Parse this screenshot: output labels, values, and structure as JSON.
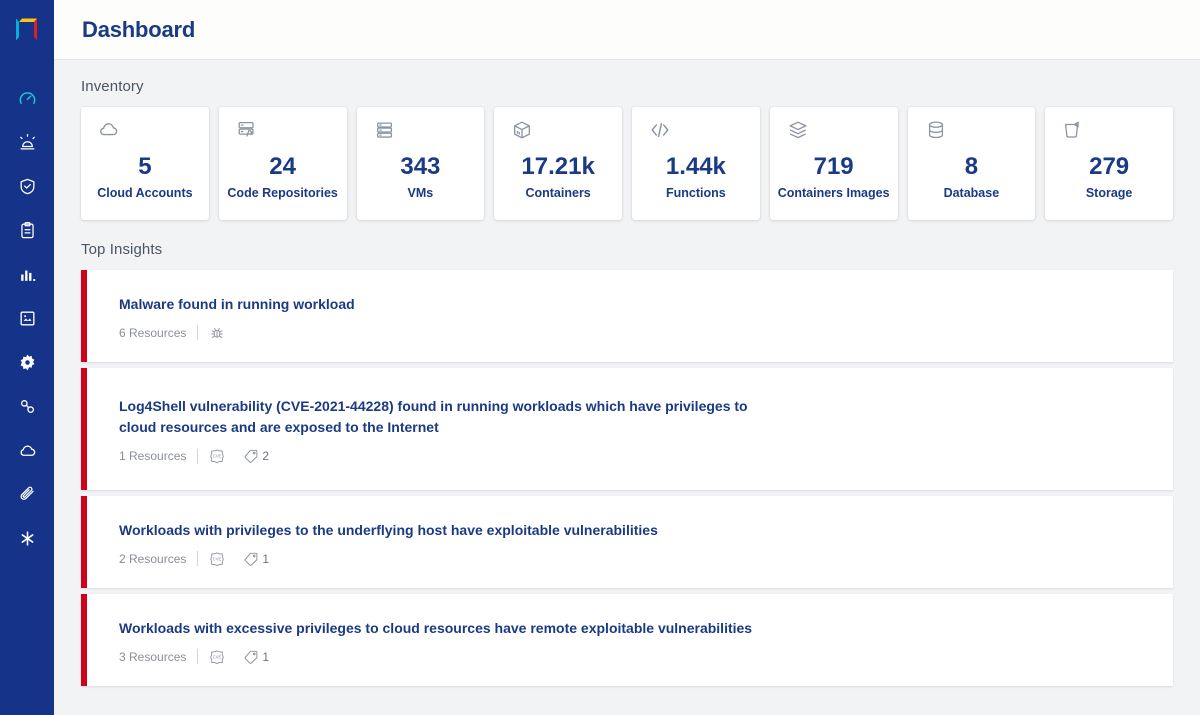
{
  "brand": {
    "logo_name": "cube-logo",
    "sidebar_color": "#143389",
    "accent_active": "#22c3d6",
    "title_color": "#1b3a84",
    "alert_color": "#d0021b"
  },
  "header": {
    "title": "Dashboard"
  },
  "sidebar": {
    "items": [
      {
        "icon": "speedometer-icon",
        "name": "dashboard",
        "active": true
      },
      {
        "icon": "alarm-bell-icon",
        "name": "alerts",
        "active": false
      },
      {
        "icon": "shield-check-icon",
        "name": "compliance",
        "active": false
      },
      {
        "icon": "clipboard-icon",
        "name": "reports",
        "active": false
      },
      {
        "icon": "bar-chart-icon",
        "name": "analytics",
        "active": false
      },
      {
        "icon": "image-box-icon",
        "name": "images",
        "active": false
      },
      {
        "icon": "gear-icon",
        "name": "settings",
        "active": false
      },
      {
        "icon": "link-chain-icon",
        "name": "integrations",
        "active": false
      },
      {
        "icon": "cloud-icon",
        "name": "cloud",
        "active": false
      },
      {
        "icon": "paperclip-icon",
        "name": "attachments",
        "active": false
      },
      {
        "icon": "tools-icon",
        "name": "tools",
        "active": false
      }
    ]
  },
  "inventory": {
    "title": "Inventory",
    "cards": [
      {
        "icon": "cloud-icon",
        "value": "5",
        "label": "Cloud Accounts"
      },
      {
        "icon": "code-repository-icon",
        "value": "24",
        "label": "Code Repositories"
      },
      {
        "icon": "server-stack-icon",
        "value": "343",
        "label": "VMs"
      },
      {
        "icon": "container-box-icon",
        "value": "17.21k",
        "label": "Containers"
      },
      {
        "icon": "code-brackets-icon",
        "value": "1.44k",
        "label": "Functions"
      },
      {
        "icon": "layers-icon",
        "value": "719",
        "label": "Containers Images"
      },
      {
        "icon": "database-icon",
        "value": "8",
        "label": "Database"
      },
      {
        "icon": "storage-bucket-icon",
        "value": "279",
        "label": "Storage"
      }
    ]
  },
  "top_insights": {
    "title": "Top Insights",
    "items": [
      {
        "title": "Malware found in running workload",
        "resources": "6 Resources",
        "icons": [
          {
            "icon": "bug-icon",
            "count": ""
          }
        ]
      },
      {
        "title": "Log4Shell vulnerability (CVE-2021-44228) found in running workloads which have privileges to cloud resources and are exposed to the Internet",
        "resources": "1 Resources",
        "icons": [
          {
            "icon": "cve-badge-icon",
            "count": ""
          },
          {
            "icon": "tag-icon",
            "count": "2"
          }
        ]
      },
      {
        "title": "Workloads with privileges to the underflying host have exploitable vulnerabilities",
        "resources": "2 Resources",
        "icons": [
          {
            "icon": "cve-badge-icon",
            "count": ""
          },
          {
            "icon": "tag-icon",
            "count": "1"
          }
        ]
      },
      {
        "title": "Workloads with excessive privileges to cloud resources have remote exploitable vulnerabilities",
        "resources": "3 Resources",
        "icons": [
          {
            "icon": "cve-badge-icon",
            "count": ""
          },
          {
            "icon": "tag-icon",
            "count": "1"
          }
        ]
      }
    ]
  }
}
